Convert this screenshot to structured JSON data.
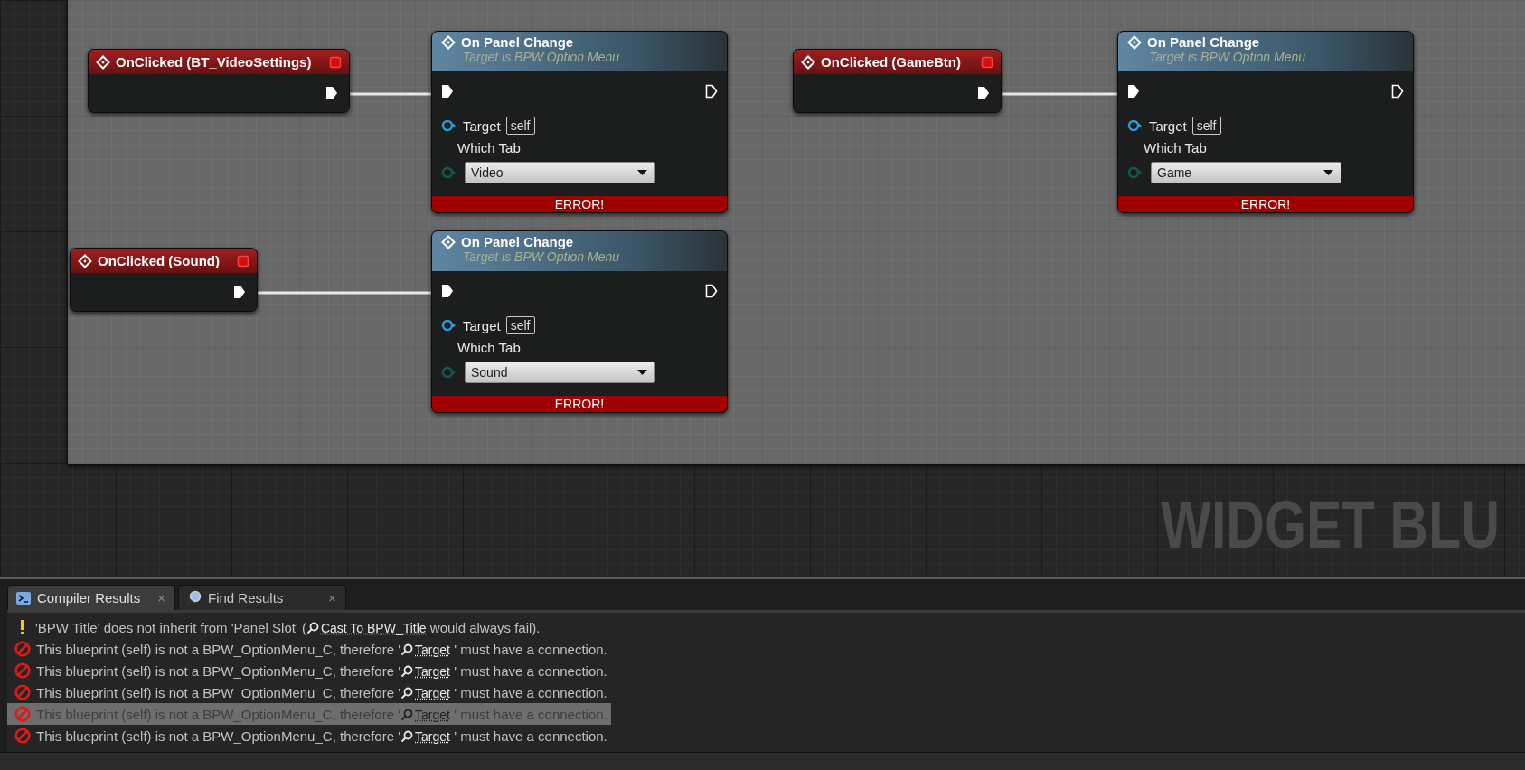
{
  "graph": {
    "watermark": "WIDGET BLU",
    "nodes": [
      {
        "kind": "event",
        "title": "OnClicked (BT_VideoSettings)"
      },
      {
        "kind": "function",
        "title": "On Panel Change",
        "subtitle": "Target is BPW Option Menu",
        "target_label": "Target",
        "target_value": "self",
        "param_label": "Which Tab",
        "param_value": "Video",
        "error": "ERROR!"
      },
      {
        "kind": "event",
        "title": "OnClicked (GameBtn)"
      },
      {
        "kind": "function",
        "title": "On Panel Change",
        "subtitle": "Target is BPW Option Menu",
        "target_label": "Target",
        "target_value": "self",
        "param_label": "Which Tab",
        "param_value": "Game",
        "error": "ERROR!"
      },
      {
        "kind": "event",
        "title": "OnClicked (Sound)"
      },
      {
        "kind": "function",
        "title": "On Panel Change",
        "subtitle": "Target is BPW Option Menu",
        "target_label": "Target",
        "target_value": "self",
        "param_label": "Which Tab",
        "param_value": "Sound",
        "error": "ERROR!"
      }
    ]
  },
  "results_panel": {
    "tabs": [
      {
        "label": "Compiler Results",
        "close": "×",
        "selected": true
      },
      {
        "label": "Find Results",
        "close": "×",
        "selected": false
      }
    ],
    "messages": [
      {
        "kind": "warning",
        "before": "'BPW Title' does not inherit from 'Panel Slot' (",
        "link": "Cast To BPW_Title",
        "after": "  would always fail).",
        "selected": false
      },
      {
        "kind": "error",
        "before": "This blueprint (self) is not a BPW_OptionMenu_C, therefore '",
        "link": "Target",
        "after": " ' must have a connection.",
        "selected": false
      },
      {
        "kind": "error",
        "before": "This blueprint (self) is not a BPW_OptionMenu_C, therefore '",
        "link": "Target",
        "after": " ' must have a connection.",
        "selected": false
      },
      {
        "kind": "error",
        "before": "This blueprint (self) is not a BPW_OptionMenu_C, therefore '",
        "link": "Target",
        "after": " ' must have a connection.",
        "selected": false
      },
      {
        "kind": "error",
        "before": "This blueprint (self) is not a BPW_OptionMenu_C, therefore '",
        "link": "Target",
        "after": " ' must have a connection.",
        "selected": true
      },
      {
        "kind": "error",
        "before": "This blueprint (self) is not a BPW_OptionMenu_C, therefore '",
        "link": "Target",
        "after": " ' must have a connection.",
        "selected": false
      }
    ]
  }
}
